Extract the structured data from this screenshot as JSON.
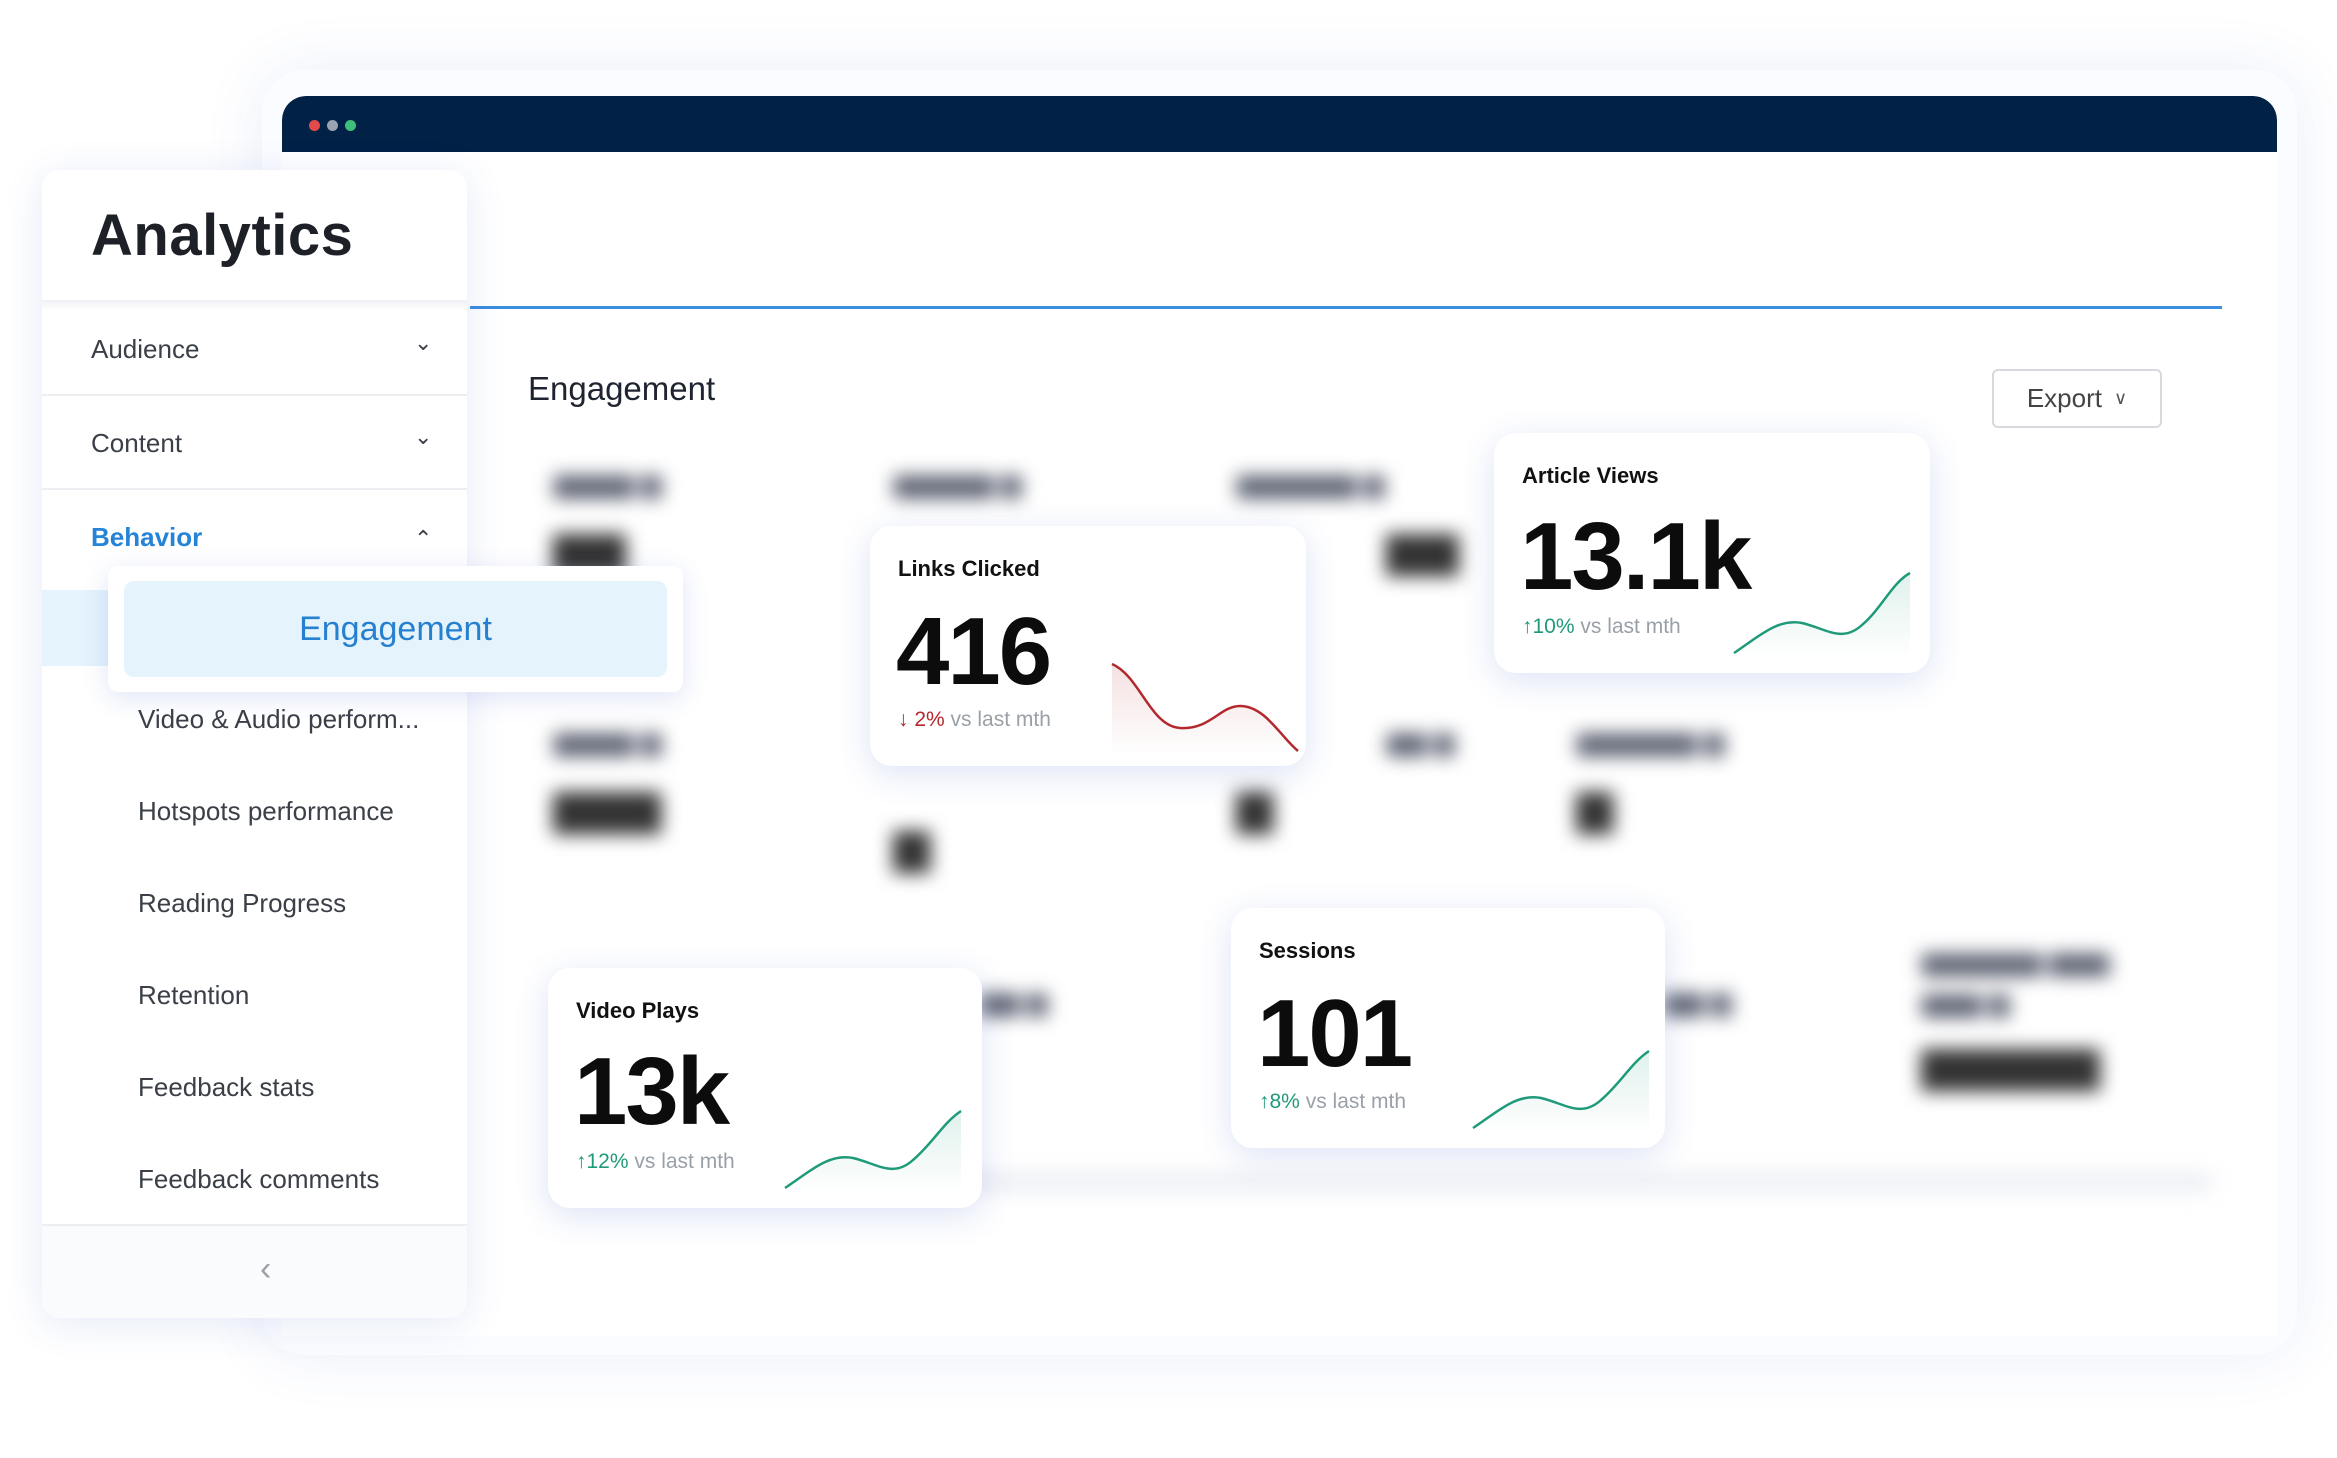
{
  "sidebar": {
    "title": "Analytics",
    "groups": [
      {
        "label": "Audience",
        "chevron": "chevron-down-icon"
      },
      {
        "label": "Content",
        "chevron": "chevron-down-icon"
      },
      {
        "label": "Behavior",
        "chevron": "chevron-up-icon"
      }
    ],
    "selected_item": "Engagement",
    "items": [
      "Video & Audio perform...",
      "Hotspots performance",
      "Reading Progress",
      "Retention",
      "Feedback stats",
      "Feedback comments"
    ],
    "collapse_icon": "chevron-left-icon"
  },
  "main": {
    "section_title": "Engagement",
    "export_label": "Export"
  },
  "cards": {
    "links_clicked": {
      "title": "Links Clicked",
      "value": "416",
      "change": "2%",
      "direction": "down",
      "suffix": "vs last mth"
    },
    "article_views": {
      "title": "Article Views",
      "value": "13.1k",
      "change": "10%",
      "direction": "up",
      "suffix": "vs last mth"
    },
    "video_plays": {
      "title": "Video Plays",
      "value": "13k",
      "change": "12%",
      "direction": "up",
      "suffix": "vs last mth"
    },
    "sessions": {
      "title": "Sessions",
      "value": "101",
      "change": "8%",
      "direction": "up",
      "suffix": "vs last mth"
    }
  },
  "colors": {
    "titlebar": "#012146",
    "accent": "#2583d8",
    "up": "#1f9a7a",
    "down": "#b3282d"
  }
}
